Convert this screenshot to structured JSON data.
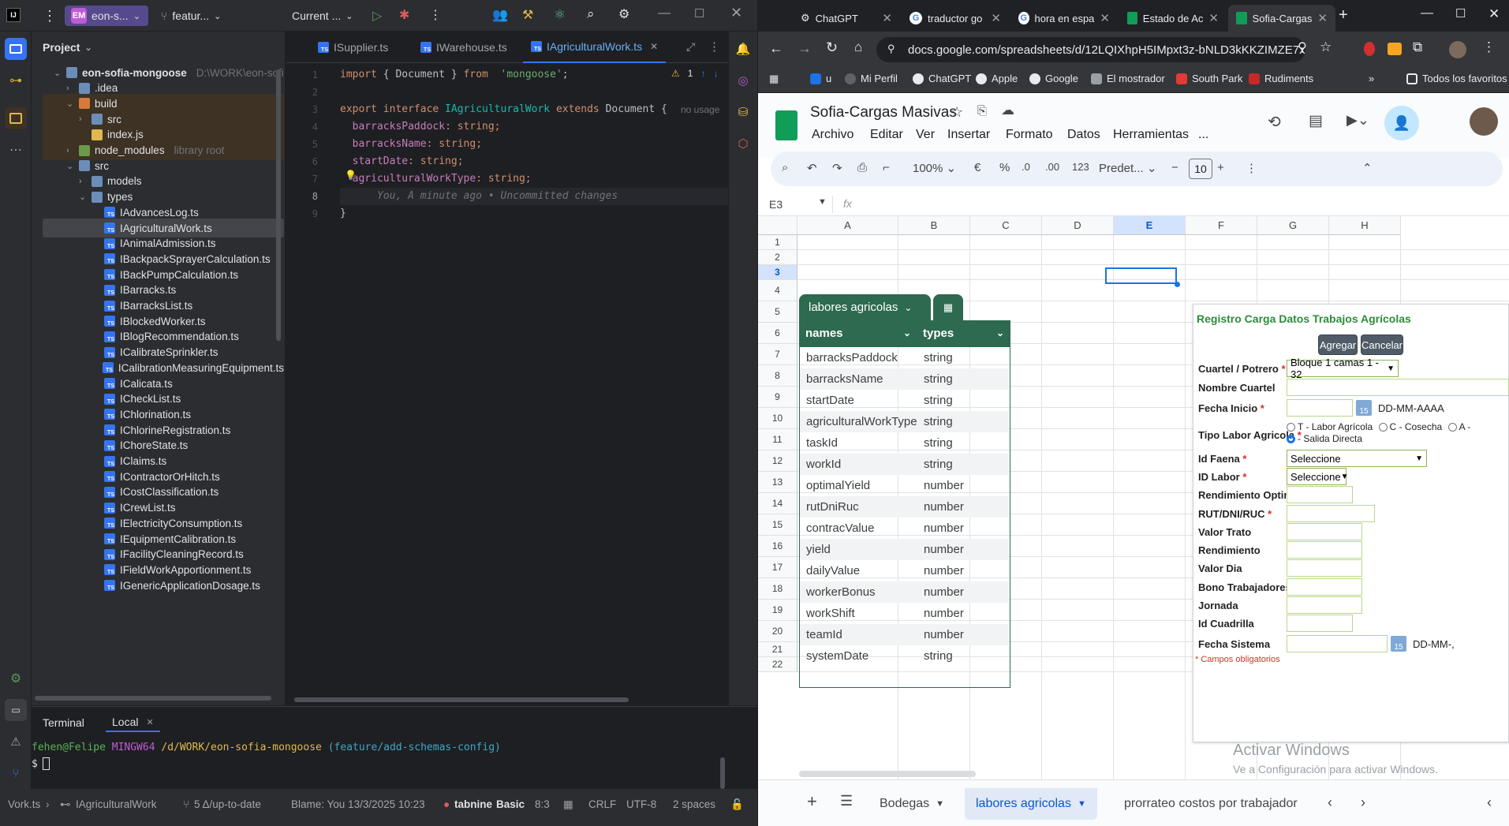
{
  "ide": {
    "project_badge": "EM",
    "project_name": "eon-s...",
    "branch": "featur...",
    "run_config": "Current ...",
    "project_panel_title": "Project",
    "tree": [
      {
        "label": "eon-sofia-mongoose",
        "sub": "D:\\WORK\\eon-sofi",
        "type": "root"
      },
      {
        "label": ".idea",
        "type": "folder"
      },
      {
        "label": "build",
        "type": "folder-orange"
      },
      {
        "label": "src",
        "type": "folder"
      },
      {
        "label": "index.js",
        "type": "file-js"
      },
      {
        "label": "node_modules",
        "sub": "library root",
        "type": "folder-lib"
      },
      {
        "label": "src",
        "type": "folder"
      },
      {
        "label": "models",
        "type": "folder"
      },
      {
        "label": "types",
        "type": "folder"
      },
      {
        "label": "IAdvancesLog.ts",
        "type": "ts"
      },
      {
        "label": "IAgriculturalWork.ts",
        "type": "ts"
      },
      {
        "label": "IAnimalAdmission.ts",
        "type": "ts"
      },
      {
        "label": "IBackpackSprayerCalculation.ts",
        "type": "ts"
      },
      {
        "label": "IBackPumpCalculation.ts",
        "type": "ts"
      },
      {
        "label": "IBarracks.ts",
        "type": "ts"
      },
      {
        "label": "IBarracksList.ts",
        "type": "ts"
      },
      {
        "label": "IBlockedWorker.ts",
        "type": "ts"
      },
      {
        "label": "IBlogRecommendation.ts",
        "type": "ts"
      },
      {
        "label": "ICalibrateSprinkler.ts",
        "type": "ts"
      },
      {
        "label": "ICalibrationMeasuringEquipment.ts",
        "type": "ts"
      },
      {
        "label": "ICalicata.ts",
        "type": "ts"
      },
      {
        "label": "ICheckList.ts",
        "type": "ts"
      },
      {
        "label": "IChlorination.ts",
        "type": "ts"
      },
      {
        "label": "IChlorineRegistration.ts",
        "type": "ts"
      },
      {
        "label": "IChoreState.ts",
        "type": "ts"
      },
      {
        "label": "IClaims.ts",
        "type": "ts"
      },
      {
        "label": "IContractorOrHitch.ts",
        "type": "ts"
      },
      {
        "label": "ICostClassification.ts",
        "type": "ts"
      },
      {
        "label": "ICrewList.ts",
        "type": "ts"
      },
      {
        "label": "IElectricityConsumption.ts",
        "type": "ts"
      },
      {
        "label": "IEquipmentCalibration.ts",
        "type": "ts"
      },
      {
        "label": "IFacilityCleaningRecord.ts",
        "type": "ts"
      },
      {
        "label": "IFieldWorkApportionment.ts",
        "type": "ts"
      },
      {
        "label": "IGenericApplicationDosage.ts",
        "type": "ts"
      }
    ],
    "editor_tabs": [
      "ISupplier.ts",
      "IWarehouse.ts",
      "IAgriculturalWork.ts"
    ],
    "line_numbers": [
      "1",
      "2",
      "3",
      "4",
      "5",
      "6",
      "7",
      "8",
      "9"
    ],
    "code": {
      "l1_import": "import",
      "l1_mid": " { Document } ",
      "l1_from": "from",
      "l1_str": "  'mongoose'",
      "l1_end": ";",
      "l3_export": "export interface",
      "l3_name": " IAgriculturalWork ",
      "l3_extends": "extends",
      "l3_doc": " Document {",
      "l3_usage": "no usage",
      "l4_field": "  barracksPaddock",
      "l4_type": ": string;",
      "l5_field": "  barracksName",
      "l5_type": ": string;",
      "l6_field": "  startDate",
      "l6_type": ": string;",
      "l7_field": "  agriculturalWorkType",
      "l7_type": ": string;",
      "l8_blame": "      You, A minute ago • Uncommitted changes",
      "l9": "}"
    },
    "warnings": "1",
    "terminal_tab": "Terminal",
    "terminal_local": "Local",
    "terminal_user": "fehen@Felipe",
    "terminal_host": "MINGW64",
    "terminal_path": "/d/WORK/eon-sofia-mongoose",
    "terminal_branch": "(feature/add-schemas-config)",
    "terminal_prompt": "$",
    "status": {
      "file": "Vork.ts",
      "symbol": "IAgriculturalWork",
      "vcs": "5 Δ/up-to-date",
      "blame": "Blame: You 13/3/2025 10:23",
      "tabnine": "tabnine",
      "tabnine_plan": "Basic",
      "pos": "8:3",
      "eol": "CRLF",
      "enc": "UTF-8",
      "indent": "2 spaces"
    }
  },
  "browser": {
    "tabs": [
      {
        "label": "ChatGPT",
        "icon": "chatgpt-icon"
      },
      {
        "label": "traductor go",
        "icon": "google-icon"
      },
      {
        "label": "hora en espa",
        "icon": "google-icon"
      },
      {
        "label": "Estado de Ac",
        "icon": "sheets-icon"
      },
      {
        "label": "Sofia-Cargas",
        "icon": "sheets-icon"
      }
    ],
    "url": "docs.google.com/spreadsheets/d/12LQIXhpH5IMpxt3z-bNLD3kKKZIMZE7xl...",
    "bookmarks": [
      "u",
      "Mi Perfil",
      "ChatGPT",
      "Apple",
      "Google",
      "El mostrador",
      "South Park",
      "Rudiments"
    ],
    "bookmarks_all": "Todos los favoritos"
  },
  "sheets": {
    "title": "Sofia-Cargas Masivas",
    "menus": [
      "Archivo",
      "Editar",
      "Ver",
      "Insertar",
      "Formato",
      "Datos",
      "Herramientas",
      "..."
    ],
    "zoom": "100%",
    "currency": "€",
    "percent": "%",
    "dec_minus": ".0",
    "dec_plus": ".00",
    "number_fmt": "123",
    "font": "Predet...",
    "font_size": "10",
    "cell_ref": "E3",
    "fx": "fx",
    "columns": [
      "A",
      "B",
      "C",
      "D",
      "E",
      "F",
      "G",
      "H"
    ],
    "rows": [
      "1",
      "2",
      "3",
      "4",
      "5",
      "6",
      "7",
      "8",
      "9",
      "10",
      "11",
      "12",
      "13",
      "14",
      "15",
      "16",
      "17",
      "18",
      "19",
      "20",
      "21",
      "22"
    ],
    "table_name": "labores agricolas",
    "table_headers": [
      "names",
      "types"
    ],
    "table_rows": [
      [
        "barracksPaddock",
        "string"
      ],
      [
        "barracksName",
        "string"
      ],
      [
        "startDate",
        "string"
      ],
      [
        "agriculturalWorkType",
        "string"
      ],
      [
        "taskId",
        "string"
      ],
      [
        "workId",
        "string"
      ],
      [
        "optimalYield",
        "number"
      ],
      [
        "rutDniRuc",
        "number"
      ],
      [
        "contracValue",
        "number"
      ],
      [
        "yield",
        "number"
      ],
      [
        "dailyValue",
        "number"
      ],
      [
        "workerBonus",
        "number"
      ],
      [
        "workShift",
        "number"
      ],
      [
        "teamId",
        "number"
      ],
      [
        "systemDate",
        "string"
      ]
    ],
    "form": {
      "title": "Registro Carga Datos Trabajos Agrícolas",
      "add": "Agregar",
      "cancel": "Cancelar",
      "cuartel_label": "Cuartel / Potrero",
      "cuartel_value": "Bloque 1 camas 1 - 32",
      "nombre_label": "Nombre Cuartel",
      "fecha_label": "Fecha Inicio",
      "date_fmt": "DD-MM-AAAA",
      "tipo_label": "Tipo Labor Agricola",
      "radio_t": "T - Labor Agrícola",
      "radio_c": "C - Cosecha",
      "radio_a": "A -",
      "radio_s": "- Salida Directa",
      "faena_label": "Id Faena",
      "faena_value": "Seleccione",
      "labor_label": "ID Labor",
      "labor_value": "Seleccione",
      "rend_opt_label": "Rendimiento Optimo",
      "rut_label": "RUT/DNI/RUC",
      "valor_trato_label": "Valor Trato",
      "rend_label": "Rendimiento",
      "valor_dia_label": "Valor Dia",
      "bono_label": "Bono Trabajadores",
      "jornada_label": "Jornada",
      "cuadrilla_label": "Id Cuadrilla",
      "sistema_label": "Fecha Sistema",
      "sistema_fmt": "DD-MM-,",
      "required_note": "* Campos obligatorios",
      "cal_num": "15"
    },
    "watermark_title": "Activar Windows",
    "watermark_sub": "Ve a Configuración para activar Windows.",
    "sheet_tabs": [
      "Bodegas",
      "labores agricolas",
      "prorrateo costos por trabajador"
    ],
    "active_sheet": "labores agricolas"
  },
  "colors": {
    "table_green": "#2d6a4f",
    "ide_accent": "#3574f0",
    "sheets_blue": "#0b57d0"
  }
}
